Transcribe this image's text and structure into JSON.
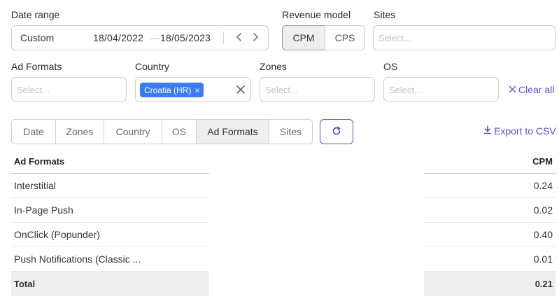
{
  "filters": {
    "date_range": {
      "label": "Date range",
      "mode": "Custom",
      "from": "18/04/2022",
      "dash": "—",
      "to": "18/05/2023"
    },
    "revenue_model": {
      "label": "Revenue model",
      "options": [
        "CPM",
        "CPS"
      ],
      "selected": "CPM"
    },
    "sites": {
      "label": "Sites",
      "placeholder": "Select..."
    },
    "ad_formats": {
      "label": "Ad Formats",
      "placeholder": "Select..."
    },
    "country": {
      "label": "Country",
      "chip": "Croatia (HR)",
      "chip_remove": "×"
    },
    "zones": {
      "label": "Zones",
      "placeholder": "Select..."
    },
    "os": {
      "label": "OS",
      "placeholder": "Select..."
    },
    "clear_all": "Clear all"
  },
  "group_by_tabs": [
    {
      "label": "Date",
      "active": false
    },
    {
      "label": "Zones",
      "active": false
    },
    {
      "label": "Country",
      "active": false
    },
    {
      "label": "OS",
      "active": false
    },
    {
      "label": "Ad Formats",
      "active": true
    },
    {
      "label": "Sites",
      "active": false
    }
  ],
  "export_label": "Export to CSV",
  "table": {
    "headers": {
      "dimension": "Ad Formats",
      "metric": "CPM"
    },
    "rows": [
      {
        "name": "Interstitial",
        "cpm": "0.24"
      },
      {
        "name": "In-Page Push",
        "cpm": "0.02"
      },
      {
        "name": "OnClick (Popunder)",
        "cpm": "0.40"
      },
      {
        "name": "Push Notifications (Classic ...",
        "cpm": "0.01"
      }
    ],
    "total": {
      "name": "Total",
      "cpm": "0.21"
    }
  },
  "colors": {
    "accent": "#5a4fcf",
    "chip": "#3b7cf5",
    "active_bg": "#eeeeee"
  },
  "icons": {
    "date_prev": "chevron-left-icon",
    "date_next": "chevron-right-icon",
    "country_clear": "close-icon",
    "clear_all": "close-icon",
    "refresh": "refresh-icon",
    "export": "download-icon"
  }
}
